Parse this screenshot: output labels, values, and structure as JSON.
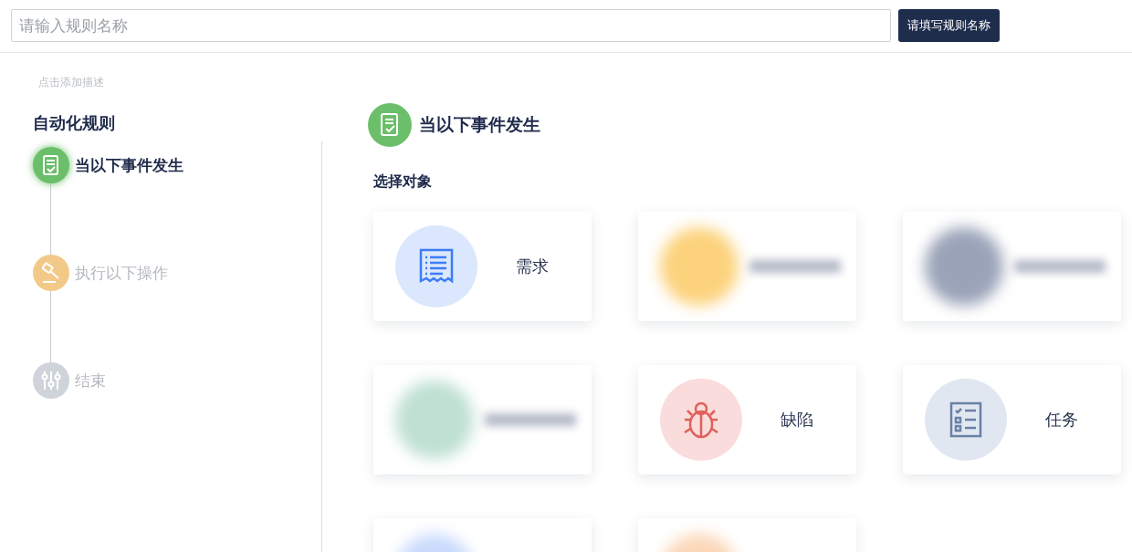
{
  "rule_name_field": {
    "placeholder": "请输入规则名称"
  },
  "tooltip": "请填写规则名称",
  "description_link": "点击添加描述",
  "sidebar": {
    "title": "自动化规则",
    "steps": [
      {
        "label": "当以下事件发生",
        "kind": "doc",
        "color": "#6cbf6a",
        "active": true
      },
      {
        "label": "执行以下操作",
        "kind": "hammer",
        "color": "#f3c98a",
        "active": false
      },
      {
        "label": "结束",
        "kind": "sliders",
        "color": "#cfd3da",
        "active": false
      }
    ]
  },
  "main": {
    "title": "当以下事件发生",
    "section": "选择对象",
    "cards": [
      {
        "kind": "list",
        "label": "需求",
        "color": "#dbe7fd"
      },
      {
        "kind": "blurred",
        "color": "#fcd27c"
      },
      {
        "kind": "blurred",
        "color": "#9aa3b8"
      },
      {
        "kind": "blurred",
        "color": "#bfe0d3"
      },
      {
        "kind": "bug",
        "label": "缺陷",
        "color": "#f9dcdb"
      },
      {
        "kind": "checklist",
        "label": "任务",
        "color": "#e1e7f0"
      },
      {
        "kind": "blurred",
        "color": "#c9dafc"
      },
      {
        "kind": "blurred",
        "color": "#fbd7b8"
      }
    ]
  }
}
